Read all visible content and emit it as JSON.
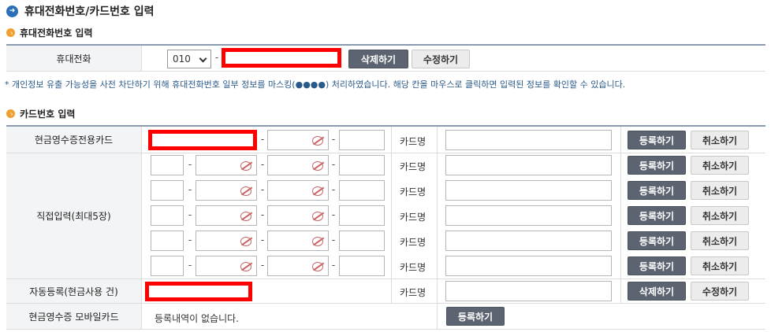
{
  "header": {
    "title": "휴대전화번호/카드번호 입력",
    "icon": "arrow-right-circle-icon"
  },
  "phone_section": {
    "title": "휴대전화번호 입력",
    "label": "휴대전화",
    "prefix_selected": "010",
    "dash": "-",
    "delete_label": "삭제하기",
    "edit_label": "수정하기"
  },
  "notice": "* 개인정보 유출 가능성을 사전 차단하기 위해 휴대전화번호 일부 정보를 마스킹(●●●●) 처리하였습니다. 해당 칸을 마우스로 클릭하면 입력된 정보를 확인할 수 있습니다.",
  "card_section": {
    "title": "카드번호 입력",
    "cash_card": {
      "label": "현금영수증전용카드",
      "cardname_label": "카드명",
      "register_label": "등록하기",
      "cancel_label": "취소하기"
    },
    "direct": {
      "label": "직접입력(최대5장)",
      "cardname_label": "카드명",
      "register_label": "등록하기",
      "cancel_label": "취소하기",
      "rows": 5
    },
    "auto": {
      "label": "자동등록(현금사용 건)",
      "cardname_label": "카드명",
      "delete_label": "삭제하기",
      "edit_label": "수정하기"
    },
    "mobile": {
      "label": "현금영수증 모바일카드",
      "status": "등록내역이 없습니다.",
      "register_label": "등록하기"
    }
  },
  "colors": {
    "dark_button": "#5b6470",
    "accent_blue": "#2a6fb8",
    "notice_text": "#2a5a8a",
    "redaction": "#ff0000"
  }
}
